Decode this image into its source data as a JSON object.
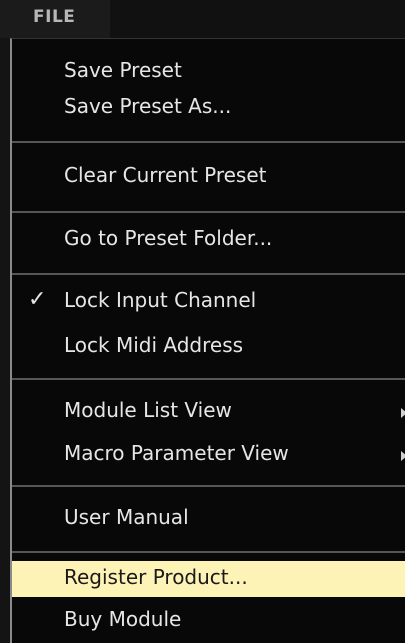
{
  "menubar": {
    "file_label": "FILE"
  },
  "menu": {
    "items": [
      {
        "label": "Save Preset"
      },
      {
        "label": "Save Preset As..."
      },
      {
        "label": "Clear Current Preset"
      },
      {
        "label": "Go to Preset Folder..."
      },
      {
        "label": "Lock Input Channel",
        "checked": true
      },
      {
        "label": "Lock Midi Address"
      },
      {
        "label": "Module List View",
        "submenu": true
      },
      {
        "label": "Macro Parameter View",
        "submenu": true
      },
      {
        "label": "User Manual"
      },
      {
        "label": "Register Product...",
        "highlighted": true
      },
      {
        "label": "Buy Module"
      }
    ],
    "check_glyph": "✓"
  },
  "colors": {
    "menu_background": "#080808",
    "menu_text": "#e6e6e6",
    "highlight_background": "#fef3b6",
    "separator": "#565656"
  }
}
